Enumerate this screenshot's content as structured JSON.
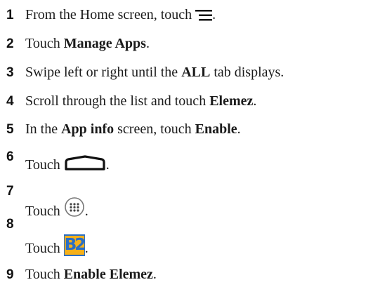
{
  "steps": [
    {
      "num": "1",
      "pre": "From the Home screen, touch ",
      "icon": "menu-icon",
      "post": "."
    },
    {
      "num": "2",
      "pre": "Touch ",
      "bold": "Manage Apps",
      "post": "."
    },
    {
      "num": "3",
      "pre": "Swipe left or right until the ",
      "bold": "ALL",
      "post": " tab displays."
    },
    {
      "num": "4",
      "pre": "Scroll through the list and touch ",
      "bold": "Elemez",
      "post": "."
    },
    {
      "num": "5",
      "pre": "In the ",
      "bold": "App info",
      "mid": " screen, touch ",
      "bold2": "Enable",
      "post": "."
    },
    {
      "num": "6",
      "pre": "Touch ",
      "icon": "home-icon",
      "post": "."
    },
    {
      "num": "7",
      "pre": "Touch ",
      "icon": "all-apps-icon",
      "post": "."
    },
    {
      "num": "8",
      "pre": "Touch ",
      "icon": "b2m-app-icon",
      "icon_text": "B2M",
      "post": "."
    },
    {
      "num": "9",
      "pre": "Touch ",
      "bold": "Enable Elemez",
      "post": "."
    }
  ],
  "colors": {
    "b2m_blue": "#2a6ec4",
    "b2m_yellow": "#f5b01a"
  }
}
